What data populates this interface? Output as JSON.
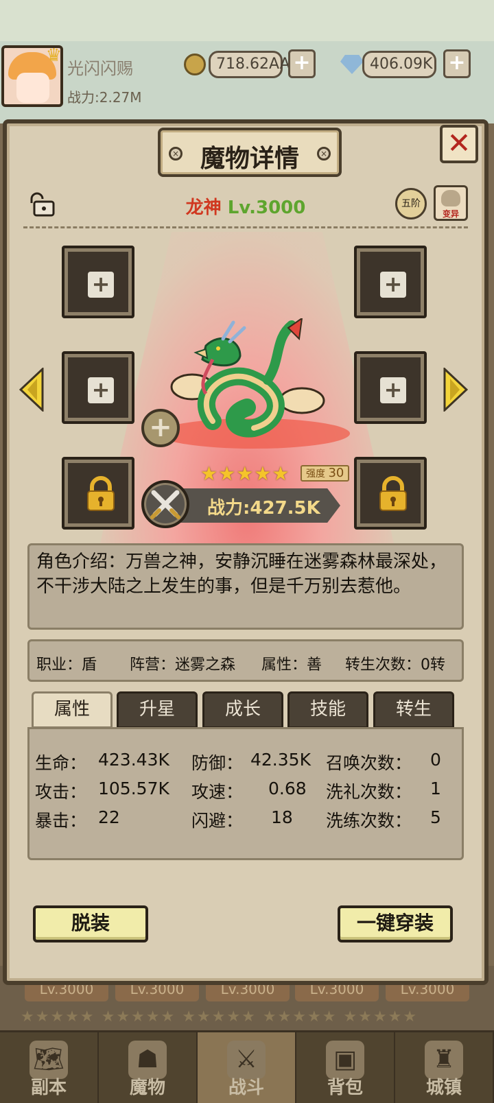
{
  "player": {
    "name": "光闪闪赐",
    "power": "战力:2.27M",
    "gold": "718.62AA",
    "diamonds": "406.09K"
  },
  "dialog": {
    "title": "魔物详情",
    "close_label": "✕",
    "monster_name": "龙神",
    "monster_level": "Lv.3000",
    "rank_badge": "五阶",
    "mutate_label": "变异",
    "star_count": 5,
    "stars": "★★★★★",
    "strength_label": "强度",
    "strength_value": "30",
    "power": "战力:427.5K",
    "description": "角色介绍：万兽之神，安静沉睡在迷雾森林最深处，不干涉大陆之上发生的事，但是千万别去惹他。",
    "info": {
      "job": "职业：盾",
      "camp": "阵营：迷雾之森",
      "alignment": "属性：善",
      "rebirth": "转生次数：0转"
    },
    "tabs": [
      {
        "label": "属性",
        "active": true
      },
      {
        "label": "升星",
        "active": false
      },
      {
        "label": "成长",
        "active": false
      },
      {
        "label": "技能",
        "active": false
      },
      {
        "label": "转生",
        "active": false
      }
    ],
    "attributes": {
      "hp_label": "生命：",
      "hp": "423.43K",
      "def_label": "防御：",
      "def": "42.35K",
      "summon_label": "召唤次数：",
      "summon": "0",
      "atk_label": "攻击：",
      "atk": "105.57K",
      "spd_label": "攻速：",
      "spd": "0.68",
      "baptism_label": "洗礼次数：",
      "baptism": "1",
      "crit_label": "暴击：",
      "crit": "22",
      "dodge_label": "闪避：",
      "dodge": "18",
      "refine_label": "洗练次数：",
      "refine": "5"
    },
    "unequip_label": "脱装",
    "equip_all_label": "一键穿装"
  },
  "background": {
    "levels": [
      "Lv.3000",
      "Lv.3000",
      "Lv.3000",
      "Lv.3000",
      "Lv.3000"
    ]
  },
  "nav": [
    {
      "label": "副本",
      "icon": "map-icon",
      "active": false
    },
    {
      "label": "魔物",
      "icon": "monster-icon",
      "active": false
    },
    {
      "label": "战斗",
      "icon": "swords-icon",
      "active": true
    },
    {
      "label": "背包",
      "icon": "backpack-icon",
      "active": false
    },
    {
      "label": "城镇",
      "icon": "castle-icon",
      "active": false
    }
  ],
  "colors": {
    "name_red": "#d0371f",
    "level_green": "#5ea52e",
    "close_red": "#b3261e",
    "star_gold": "#f5c42a",
    "button_yellow": "#f1ecaa"
  }
}
